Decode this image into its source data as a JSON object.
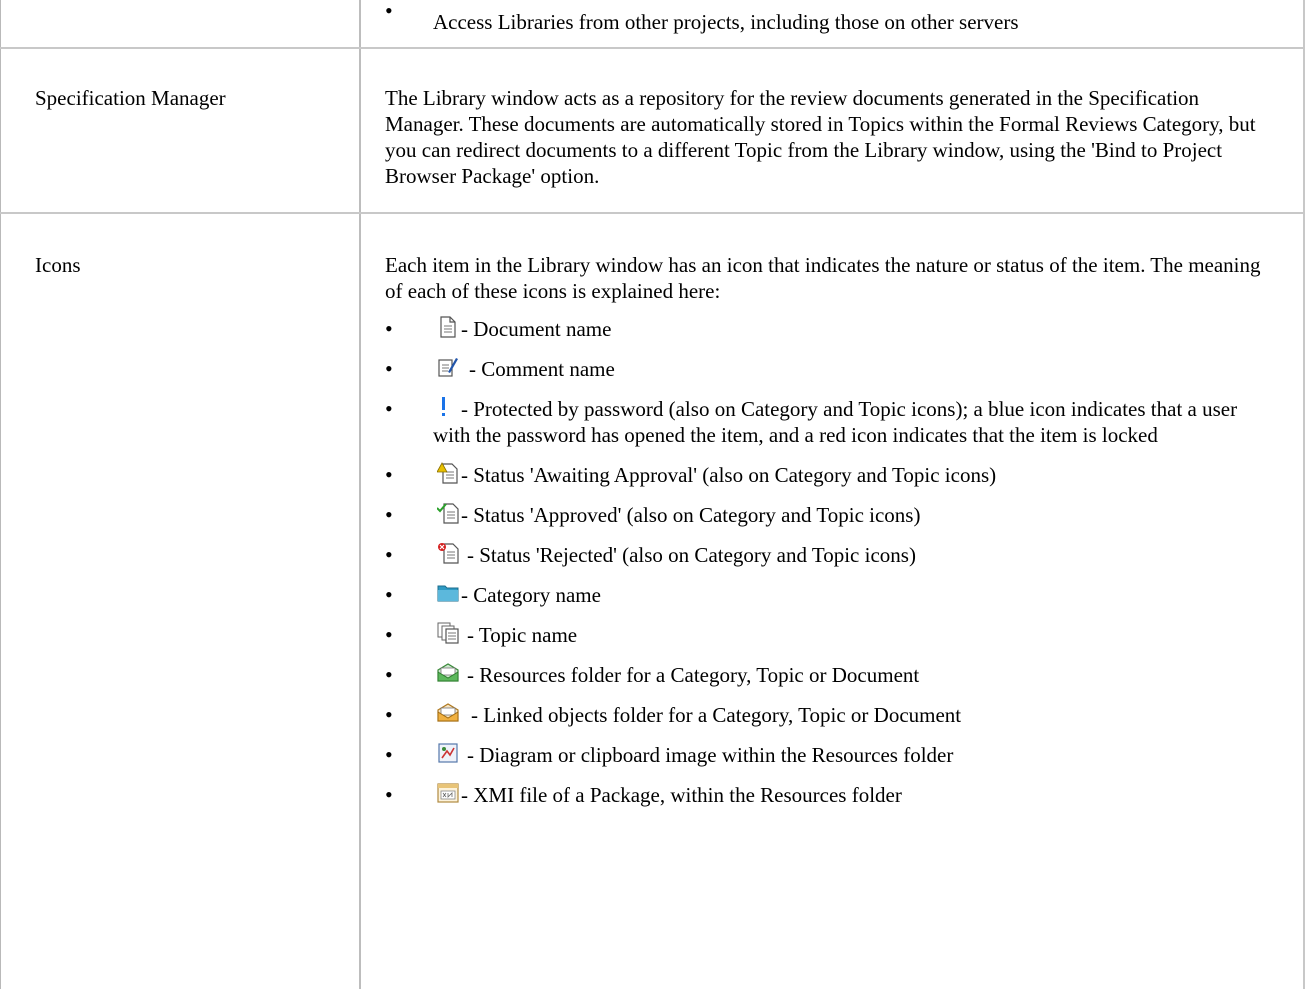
{
  "rows": [
    {
      "label": "",
      "bullets": [
        "Access Libraries from other projects, including those on other servers"
      ]
    },
    {
      "label": "Specification Manager",
      "text": "The Library window acts as a repository for the review documents generated in the Specification Manager. These documents are automatically stored in Topics within the Formal Reviews Category, but you can redirect documents to a different Topic from the Library window, using the 'Bind to Project Browser Package' option."
    },
    {
      "label": "Icons",
      "intro": "Each item in the Library window has an icon that indicates the nature or status of the item. The meaning of each of these icons is explained here:",
      "icons": [
        {
          "icon": "document-icon",
          "text": "- Document name"
        },
        {
          "icon": "comment-icon",
          "text": "- Comment name"
        },
        {
          "icon": "exclamation-icon",
          "text": "- Protected by password (also on Category and Topic icons); a blue icon indicates that a user with the password has opened the item, and a red icon indicates that the item is locked"
        },
        {
          "icon": "awaiting-approval-icon",
          "text": "- Status 'Awaiting Approval' (also on Category and Topic icons)"
        },
        {
          "icon": "approved-icon",
          "text": "- Status 'Approved' (also on Category and Topic icons)"
        },
        {
          "icon": "rejected-icon",
          "text": "- Status 'Rejected' (also on Category and Topic icons)"
        },
        {
          "icon": "category-folder-icon",
          "text": "- Category name"
        },
        {
          "icon": "topic-icon",
          "text": "- Topic name"
        },
        {
          "icon": "resources-folder-icon",
          "text": "- Resources folder for a Category, Topic or Document"
        },
        {
          "icon": "linked-objects-folder-icon",
          "text": "- Linked objects folder for a Category, Topic or Document"
        },
        {
          "icon": "diagram-image-icon",
          "text": "- Diagram or clipboard image within the Resources folder"
        },
        {
          "icon": "xmi-file-icon",
          "text": "- XMI file of a Package, within the Resources folder"
        }
      ]
    }
  ],
  "colors": {
    "exclamation": "#1a73e8",
    "category_folder": "#2e9ac4",
    "approved": "#2aa12a",
    "rejected": "#d42020",
    "awaiting": "#e8c000"
  }
}
